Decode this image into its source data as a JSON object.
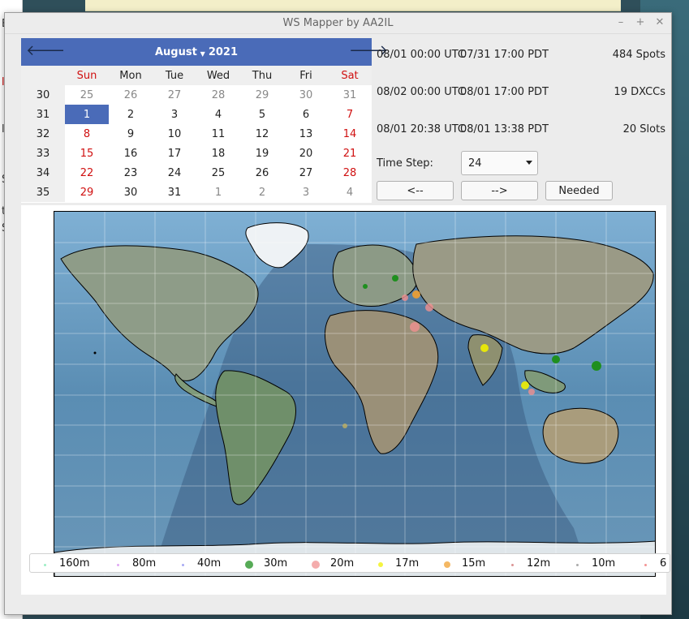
{
  "window": {
    "title": "WS Mapper by AA2IL"
  },
  "calendar": {
    "month": "August",
    "year": "2021",
    "weekday_headers": [
      "Sun",
      "Mon",
      "Tue",
      "Wed",
      "Thu",
      "Fri",
      "Sat"
    ],
    "weeks": [
      {
        "wk": "30",
        "days": [
          "25",
          "26",
          "27",
          "28",
          "29",
          "30",
          "31"
        ]
      },
      {
        "wk": "31",
        "days": [
          "1",
          "2",
          "3",
          "4",
          "5",
          "6",
          "7"
        ]
      },
      {
        "wk": "32",
        "days": [
          "8",
          "9",
          "10",
          "11",
          "12",
          "13",
          "14"
        ]
      },
      {
        "wk": "33",
        "days": [
          "15",
          "16",
          "17",
          "18",
          "19",
          "20",
          "21"
        ]
      },
      {
        "wk": "34",
        "days": [
          "22",
          "23",
          "24",
          "25",
          "26",
          "27",
          "28"
        ]
      },
      {
        "wk": "35",
        "days": [
          "29",
          "30",
          "31",
          "1",
          "2",
          "3",
          "4"
        ]
      }
    ],
    "selected": "1"
  },
  "info": {
    "row1": {
      "utc": "08/01 00:00 UTC",
      "local": "07/31 17:00 PDT",
      "value": "484 Spots"
    },
    "row2": {
      "utc": "08/02 00:00 UTC",
      "local": "08/01 17:00 PDT",
      "value": "19 DXCCs"
    },
    "row3": {
      "utc": "08/01 20:38 UTC",
      "local": "08/01 13:38 PDT",
      "value": "20 Slots"
    }
  },
  "time_step": {
    "label": "Time Step:",
    "value": "24"
  },
  "buttons": {
    "prev": "<--",
    "next": "-->",
    "needed": "Needed"
  },
  "legend": [
    {
      "label": "160m",
      "color": "#7be8b0"
    },
    {
      "label": "80m",
      "color": "#d78cf0"
    },
    {
      "label": "40m",
      "color": "#8a8cf0"
    },
    {
      "label": "30m",
      "color": "#1f8f1f"
    },
    {
      "label": "20m",
      "color": "#f09090"
    },
    {
      "label": "17m",
      "color": "#f0f000"
    },
    {
      "label": "15m",
      "color": "#f0a030"
    },
    {
      "label": "12m",
      "color": "#d07070"
    },
    {
      "label": "10m",
      "color": "#909090"
    },
    {
      "label": "6",
      "color": "#f07070"
    }
  ],
  "background": {
    "left_fragments": [
      "E",
      "le",
      "l",
      "S",
      "t",
      "S"
    ]
  }
}
